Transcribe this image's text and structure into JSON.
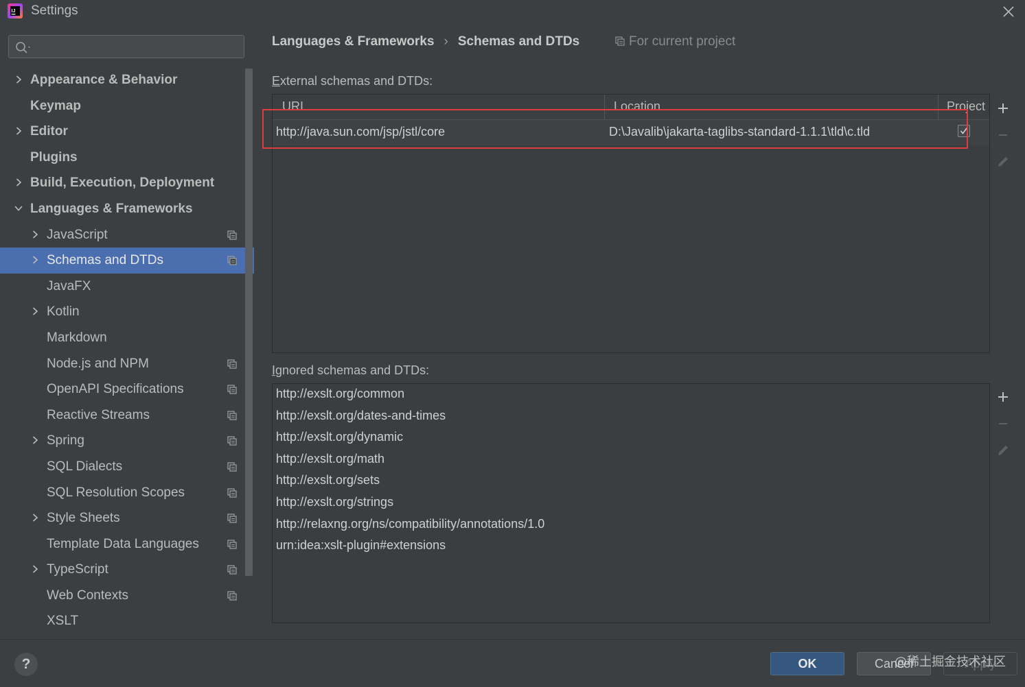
{
  "window": {
    "title": "Settings",
    "app_icon_text": "IJ"
  },
  "search": {
    "value": "",
    "placeholder": ""
  },
  "sidebar": {
    "items": [
      {
        "label": "Appearance & Behavior",
        "level": 0,
        "expandable": true,
        "expanded": false,
        "project_icon": false,
        "selected": false
      },
      {
        "label": "Keymap",
        "level": 0,
        "expandable": false,
        "expanded": false,
        "project_icon": false,
        "selected": false
      },
      {
        "label": "Editor",
        "level": 0,
        "expandable": true,
        "expanded": false,
        "project_icon": false,
        "selected": false
      },
      {
        "label": "Plugins",
        "level": 0,
        "expandable": false,
        "expanded": false,
        "project_icon": false,
        "selected": false
      },
      {
        "label": "Build, Execution, Deployment",
        "level": 0,
        "expandable": true,
        "expanded": false,
        "project_icon": false,
        "selected": false
      },
      {
        "label": "Languages & Frameworks",
        "level": 0,
        "expandable": true,
        "expanded": true,
        "project_icon": false,
        "selected": false
      },
      {
        "label": "JavaScript",
        "level": 1,
        "expandable": true,
        "expanded": false,
        "project_icon": true,
        "selected": false
      },
      {
        "label": "Schemas and DTDs",
        "level": 1,
        "expandable": true,
        "expanded": false,
        "project_icon": true,
        "selected": true
      },
      {
        "label": "JavaFX",
        "level": 1,
        "expandable": false,
        "expanded": false,
        "project_icon": false,
        "selected": false
      },
      {
        "label": "Kotlin",
        "level": 1,
        "expandable": true,
        "expanded": false,
        "project_icon": false,
        "selected": false
      },
      {
        "label": "Markdown",
        "level": 1,
        "expandable": false,
        "expanded": false,
        "project_icon": false,
        "selected": false
      },
      {
        "label": "Node.js and NPM",
        "level": 1,
        "expandable": false,
        "expanded": false,
        "project_icon": true,
        "selected": false
      },
      {
        "label": "OpenAPI Specifications",
        "level": 1,
        "expandable": false,
        "expanded": false,
        "project_icon": true,
        "selected": false
      },
      {
        "label": "Reactive Streams",
        "level": 1,
        "expandable": false,
        "expanded": false,
        "project_icon": true,
        "selected": false
      },
      {
        "label": "Spring",
        "level": 1,
        "expandable": true,
        "expanded": false,
        "project_icon": true,
        "selected": false
      },
      {
        "label": "SQL Dialects",
        "level": 1,
        "expandable": false,
        "expanded": false,
        "project_icon": true,
        "selected": false
      },
      {
        "label": "SQL Resolution Scopes",
        "level": 1,
        "expandable": false,
        "expanded": false,
        "project_icon": true,
        "selected": false
      },
      {
        "label": "Style Sheets",
        "level": 1,
        "expandable": true,
        "expanded": false,
        "project_icon": true,
        "selected": false
      },
      {
        "label": "Template Data Languages",
        "level": 1,
        "expandable": false,
        "expanded": false,
        "project_icon": true,
        "selected": false
      },
      {
        "label": "TypeScript",
        "level": 1,
        "expandable": true,
        "expanded": false,
        "project_icon": true,
        "selected": false
      },
      {
        "label": "Web Contexts",
        "level": 1,
        "expandable": false,
        "expanded": false,
        "project_icon": true,
        "selected": false
      },
      {
        "label": "XSLT",
        "level": 1,
        "expandable": false,
        "expanded": false,
        "project_icon": false,
        "selected": false
      }
    ]
  },
  "breadcrumb": {
    "parent": "Languages & Frameworks",
    "separator": "›",
    "current": "Schemas and DTDs",
    "scope": "For current project"
  },
  "external": {
    "label_first": "E",
    "label_rest": "xternal schemas and DTDs:",
    "columns": [
      "URI",
      "Location",
      "Project"
    ],
    "rows": [
      {
        "uri": "http://java.sun.com/jsp/jstl/core",
        "location": "D:\\Javalib\\jakarta-taglibs-standard-1.1.1\\tld\\c.tld",
        "project": true
      }
    ]
  },
  "ignored": {
    "label_first": "I",
    "label_rest": "gnored schemas and DTDs:",
    "items": [
      "http://exslt.org/common",
      "http://exslt.org/dates-and-times",
      "http://exslt.org/dynamic",
      "http://exslt.org/math",
      "http://exslt.org/sets",
      "http://exslt.org/strings",
      "http://relaxng.org/ns/compatibility/annotations/1.0",
      "urn:idea:xslt-plugin#extensions"
    ]
  },
  "buttons": {
    "help": "?",
    "ok": "OK",
    "cancel": "Cancel",
    "apply": "Apply"
  },
  "watermark": "@稀土掘金技术社区",
  "colors": {
    "background": "#3c3f41",
    "selection": "#4b6eaf",
    "ok_button": "#365880",
    "highlight": "#e03c3c"
  }
}
